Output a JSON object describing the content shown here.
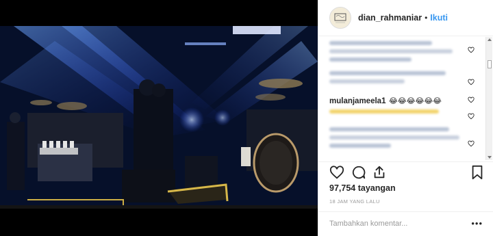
{
  "header": {
    "username": "dian_rahmaniar",
    "separator": "•",
    "follow_label": "Ikuti",
    "avatar_icon": "sketch-avatar"
  },
  "comments": [
    {
      "kind": "blurred",
      "lines": 3
    },
    {
      "kind": "blurred",
      "lines": 2
    },
    {
      "kind": "named",
      "username": "mulanjameela1",
      "text": "😂😂😂😂😂😂"
    },
    {
      "kind": "blurred",
      "lines": 1
    },
    {
      "kind": "blurred",
      "lines": 3
    }
  ],
  "actions": {
    "like_icon": "heart-icon",
    "comment_icon": "comment-icon",
    "share_icon": "share-icon",
    "save_icon": "bookmark-icon"
  },
  "stats": {
    "views": "97,754 tayangan",
    "timestamp": "18 JAM YANG LALU"
  },
  "add_comment": {
    "placeholder": "Tambahkan komentar...",
    "more_label": "•••"
  },
  "colors": {
    "link": "#3897f0",
    "stage_blue": "#2b6cff",
    "stage_yellow": "#e3c54a"
  }
}
